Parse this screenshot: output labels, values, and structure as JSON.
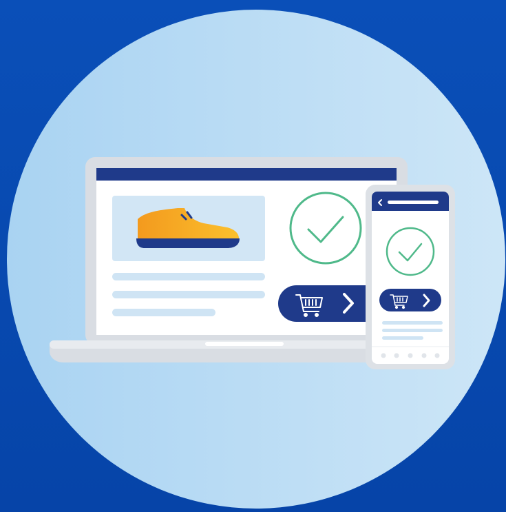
{
  "scene": {
    "kind": "illustration",
    "colors": {
      "background_top": "#0a4fb8",
      "background_bottom": "#0644a8",
      "circle_left": "#a9d3f2",
      "circle_right": "#cde6f7",
      "navy": "#1f3a8a",
      "laptop_frame": "#d9dde3",
      "laptop_screen_bg": "#ffffff",
      "product_card_bg": "#d2e6f5",
      "text_line": "#cfe4f4",
      "check_green": "#4fb98a",
      "shoe_orange": "#f6a623",
      "shoe_sole": "#1f3a8a"
    }
  },
  "icons": {
    "laptop": "laptop-icon",
    "phone": "smartphone-icon",
    "shoe": "sneaker-icon",
    "check": "checkmark-circle-icon",
    "cart": "shopping-cart-icon",
    "arrow": "chevron-right-icon",
    "back": "chevron-left-icon"
  }
}
